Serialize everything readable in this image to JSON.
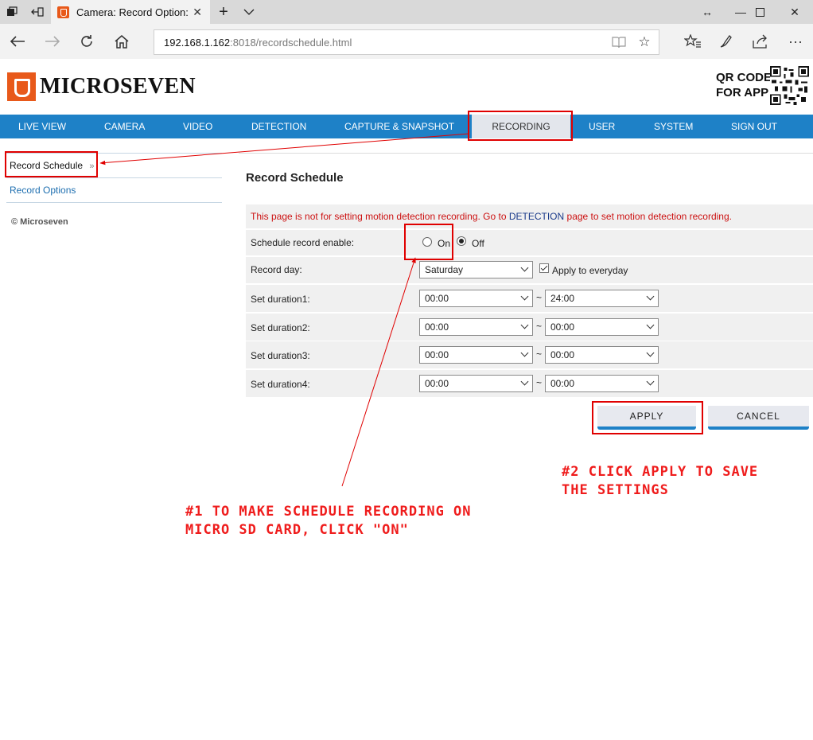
{
  "browser": {
    "tab_title": "Camera: Record Option:",
    "url_host": "192.168.1.162",
    "url_path": ":8018/recordschedule.html",
    "icons": [
      "tab-actions-icon",
      "set-aside-tabs-icon",
      "close-icon",
      "new-tab-icon",
      "tab-list-icon",
      "resize-icon",
      "minimize-icon",
      "maximize-icon",
      "close-window-icon",
      "back-icon",
      "forward-icon",
      "refresh-icon",
      "home-icon",
      "reading-view-icon",
      "favorite-icon",
      "favorites-hub-icon",
      "notes-icon",
      "share-icon",
      "more-icon"
    ]
  },
  "header": {
    "brand": "MICROSEVEN",
    "qr_line1": "QR CODE",
    "qr_line2": "FOR APP"
  },
  "nav": {
    "items": [
      "LIVE VIEW",
      "CAMERA",
      "VIDEO",
      "DETECTION",
      "CAPTURE & SNAPSHOT",
      "RECORDING",
      "USER",
      "SYSTEM",
      "SIGN OUT"
    ],
    "active": "RECORDING"
  },
  "sidebar": {
    "items": [
      "Record Schedule",
      "Record Options"
    ],
    "active_marker": "»",
    "copyright": "© Microseven"
  },
  "content": {
    "title": "Record Schedule",
    "notice_pre": "This page is not for setting motion detection recording. Go to ",
    "notice_link": "DETECTION",
    "notice_post": " page to set motion detection recording.",
    "schedule_label": "Schedule record enable:",
    "on_label": "On",
    "off_label": "Off",
    "enabled": "Off",
    "record_day_label": "Record day:",
    "record_day_value": "Saturday",
    "apply_everyday_label": "Apply to everyday",
    "durations": [
      {
        "label": "Set duration1:",
        "start": "00:00",
        "end": "24:00"
      },
      {
        "label": "Set duration2:",
        "start": "00:00",
        "end": "00:00"
      },
      {
        "label": "Set duration3:",
        "start": "00:00",
        "end": "00:00"
      },
      {
        "label": "Set duration4:",
        "start": "00:00",
        "end": "00:00"
      }
    ],
    "tilde": "~",
    "apply_label": "APPLY",
    "cancel_label": "CANCEL"
  },
  "annotations": {
    "note1_line1": "#1 TO MAKE SCHEDULE RECORDING ON",
    "note1_line2": "MICRO SD CARD, CLICK \"ON\"",
    "note2_line1": "#2 CLICK APPLY TO SAVE",
    "note2_line2": "THE SETTINGS",
    "color": "#e00000"
  },
  "colors": {
    "nav_blue": "#1e81c7",
    "brand_orange": "#e8591a",
    "notice_red": "#cc1111"
  }
}
